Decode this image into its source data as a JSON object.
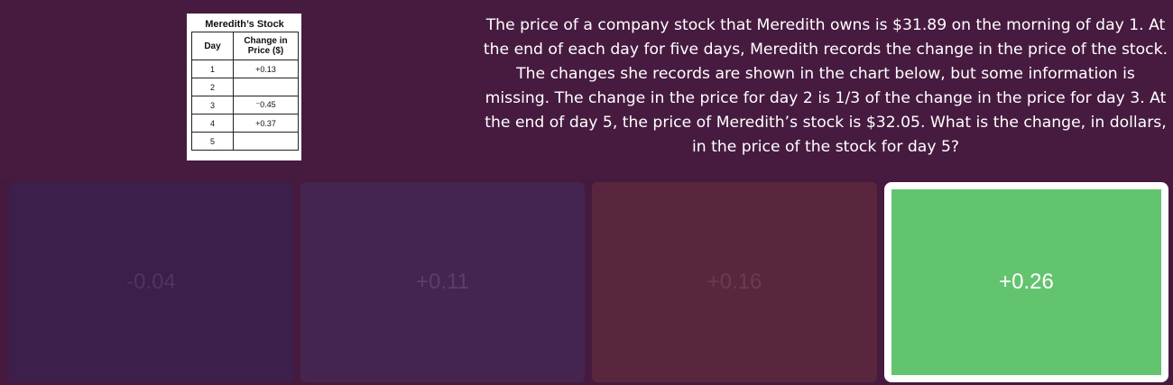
{
  "table_card": {
    "title": "Meredith’s Stock",
    "headers": {
      "day": "Day",
      "change": "Change in Price ($)"
    },
    "rows": [
      {
        "day": "1",
        "change": "+0.13"
      },
      {
        "day": "2",
        "change": ""
      },
      {
        "day": "3",
        "change": "⁻0.45"
      },
      {
        "day": "4",
        "change": "+0.37"
      },
      {
        "day": "5",
        "change": ""
      }
    ]
  },
  "question": {
    "text": "The price of a company stock that Meredith owns is $31.89 on the morning of day 1. At the end of each day for five days, Meredith records the change in the price of the stock. The changes she records are shown in the chart below, but some information is missing. The change in the price for day 2 is 1/3 of the change in the price for day 3. At the end of day 5, the price of Meredith’s stock is $32.05. What is the change, in dollars, in the price of the stock for day 5?"
  },
  "options": [
    {
      "label": "-0.04",
      "state": "dimmed",
      "color": "#3c1f4a"
    },
    {
      "label": "+0.11",
      "state": "dimmed",
      "color": "#45254f"
    },
    {
      "label": "+0.16",
      "state": "dimmed",
      "color": "#5a263e"
    },
    {
      "label": "+0.26",
      "state": "correct",
      "color": "#63c46f"
    }
  ]
}
